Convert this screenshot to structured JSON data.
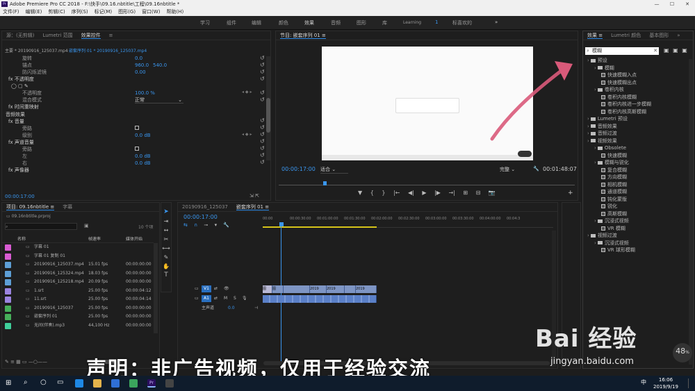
{
  "window": {
    "title": "Adobe Premiere Pro CC 2018 - F:\\快手\\09.16.nbtitle\\工程\\09.16nbtitle *",
    "app_icon": "Pr",
    "win_min": "—",
    "win_max": "☐",
    "win_close": "✕"
  },
  "menu": [
    "文件(F)",
    "编辑(E)",
    "剪辑(C)",
    "序列(S)",
    "标记(M)",
    "图形(G)",
    "窗口(W)",
    "帮助(H)"
  ],
  "workspaces": {
    "items": [
      "学习",
      "组件",
      "编辑",
      "颜色",
      "效果",
      "音频",
      "图形",
      "库",
      "Learning",
      "1",
      "标喜欢的"
    ],
    "more": "»"
  },
  "effect_controls": {
    "tabs": [
      "源：(无剪辑)",
      "Lumetri 范围",
      "效果控件",
      "≡"
    ],
    "header": {
      "master": "主要 * 20190916_125037.mp4",
      "seq": "嵌套序列 01 * 20190916_125037.mp4"
    },
    "rows": [
      {
        "label": "旋转",
        "v1": "0.0",
        "v2": ""
      },
      {
        "label": "锚点",
        "v1": "960.0",
        "v2": "540.0"
      },
      {
        "label": "防闪烁滤镜",
        "v1": "0.00",
        "v2": ""
      },
      {
        "label": "不透明度",
        "v1": "",
        "v2": ""
      },
      {
        "label": "",
        "v1": "",
        "v2": ""
      },
      {
        "label": "不透明度",
        "v1": "100.0 %",
        "v2": ""
      },
      {
        "label": "混合模式",
        "v1": "正常",
        "v2": ""
      },
      {
        "label": "时间重映射",
        "v1": "",
        "v2": ""
      },
      {
        "label": "音频效果",
        "v1": "",
        "v2": ""
      },
      {
        "label": "音量",
        "v1": "",
        "v2": ""
      },
      {
        "label": "旁路",
        "v1": "",
        "v2": ""
      },
      {
        "label": "级别",
        "v1": "0.0 dB",
        "v2": ""
      },
      {
        "label": "声道音量",
        "v1": "",
        "v2": ""
      },
      {
        "label": "旁路",
        "v1": "",
        "v2": ""
      },
      {
        "label": "左",
        "v1": "0.0 dB",
        "v2": ""
      },
      {
        "label": "右",
        "v1": "0.0 dB",
        "v2": ""
      },
      {
        "label": "声像器",
        "v1": "",
        "v2": ""
      }
    ],
    "timecode": "00:00:17:00"
  },
  "program": {
    "title": "节目: 嵌套序列 01 ≡",
    "timecode": "00:00:17:00",
    "fit": "适合",
    "quality": "完整",
    "duration": "00:01:48:07",
    "controls": [
      "▼",
      "{",
      "}",
      "|←",
      "◀|",
      "▶",
      "|▶",
      "→|",
      "⊞",
      "⊟",
      "📷",
      "+"
    ]
  },
  "project": {
    "tabs": [
      "项目: 09.16nbtitle ≡",
      "字幕"
    ],
    "file": "09.16nbtitle.prproj",
    "count": "10 个项",
    "cols": [
      "名称",
      "帧速率",
      "媒体开始"
    ],
    "items": [
      {
        "name": "字幕 01",
        "fps": "",
        "start": "",
        "color": "#d85bd2"
      },
      {
        "name": "字幕 01 复制 01",
        "fps": "",
        "start": "",
        "color": "#d85bd2"
      },
      {
        "name": "20190916_125037.mp4",
        "fps": "15.01 fps",
        "start": "00:00:00:00",
        "color": "#5d9fd6"
      },
      {
        "name": "20190916_125324.mp4",
        "fps": "18.03 fps",
        "start": "00:00:00:00",
        "color": "#5d9fd6"
      },
      {
        "name": "20190916_125218.mp4",
        "fps": "20.09 fps",
        "start": "00:00:00:00",
        "color": "#5d9fd6"
      },
      {
        "name": "1.srt",
        "fps": "25.00 fps",
        "start": "00:00:04:12",
        "color": "#9b84e0"
      },
      {
        "name": "11.srt",
        "fps": "25.00 fps",
        "start": "00:00:04:14",
        "color": "#9b84e0"
      },
      {
        "name": "20190916_125037",
        "fps": "25.00 fps",
        "start": "00:00:00:00",
        "color": "#46b05a"
      },
      {
        "name": "嵌套序列 01",
        "fps": "25.00 fps",
        "start": "00:00:00:00",
        "color": "#46b05a"
      },
      {
        "name": "无间(伴奏).mp3",
        "fps": "44,100 Hz",
        "start": "00:00:00:00",
        "color": "#3fcf9a"
      }
    ]
  },
  "timeline": {
    "tabs": [
      "20190916_125037",
      "嵌套序列 01 ≡"
    ],
    "timecode": "00:00:17:00",
    "ruler": [
      "00:00",
      "00:00:30:00",
      "00:01:00:00",
      "00:01:30:00",
      "00:02:00:00",
      "00:02:30:00",
      "00:03:00:00",
      "00:03:30:00",
      "00:04:00:00",
      "00:04:3"
    ],
    "tracks": {
      "v1": "V1",
      "a1": "A1",
      "master": "主声道",
      "master_val": "0.0"
    },
    "clips": [
      "图",
      "图",
      "2019",
      "2019",
      "2019"
    ]
  },
  "effects": {
    "tabs": [
      "效果 ≡",
      "Lumetri 颜色",
      "基本图形",
      "»"
    ],
    "search": "模糊",
    "tree": [
      {
        "t": "预设",
        "lvl": 0,
        "kind": "folder"
      },
      {
        "t": "模糊",
        "lvl": 1,
        "kind": "folder"
      },
      {
        "t": "快速模糊入点",
        "lvl": 2,
        "kind": "fx"
      },
      {
        "t": "快速模糊出点",
        "lvl": 2,
        "kind": "fx"
      },
      {
        "t": "卷积内核",
        "lvl": 1,
        "kind": "folder"
      },
      {
        "t": "卷积内核模糊",
        "lvl": 2,
        "kind": "fx"
      },
      {
        "t": "卷积内核进一步模糊",
        "lvl": 2,
        "kind": "fx"
      },
      {
        "t": "卷积内核高斯模糊",
        "lvl": 2,
        "kind": "fx"
      },
      {
        "t": "Lumetri 预设",
        "lvl": 0,
        "kind": "folder"
      },
      {
        "t": "音频效果",
        "lvl": 0,
        "kind": "folder"
      },
      {
        "t": "音频过渡",
        "lvl": 0,
        "kind": "folder"
      },
      {
        "t": "视频效果",
        "lvl": 0,
        "kind": "folder"
      },
      {
        "t": "Obsolete",
        "lvl": 1,
        "kind": "folder"
      },
      {
        "t": "快速模糊",
        "lvl": 2,
        "kind": "fx"
      },
      {
        "t": "模糊与锐化",
        "lvl": 1,
        "kind": "folder"
      },
      {
        "t": "复合模糊",
        "lvl": 2,
        "kind": "fx"
      },
      {
        "t": "方向模糊",
        "lvl": 2,
        "kind": "fx"
      },
      {
        "t": "相机模糊",
        "lvl": 2,
        "kind": "fx"
      },
      {
        "t": "通道模糊",
        "lvl": 2,
        "kind": "fx"
      },
      {
        "t": "钝化蒙版",
        "lvl": 2,
        "kind": "fx"
      },
      {
        "t": "锐化",
        "lvl": 2,
        "kind": "fx"
      },
      {
        "t": "高斯模糊",
        "lvl": 2,
        "kind": "fx"
      },
      {
        "t": "沉浸式视频",
        "lvl": 1,
        "kind": "folder"
      },
      {
        "t": "VR 模糊",
        "lvl": 2,
        "kind": "fx"
      },
      {
        "t": "视频过渡",
        "lvl": 0,
        "kind": "folder"
      },
      {
        "t": "沉浸式视频",
        "lvl": 1,
        "kind": "folder"
      },
      {
        "t": "VR 球形模糊",
        "lvl": 2,
        "kind": "fx"
      }
    ]
  },
  "overlay": {
    "caption": "声明：非广告视频，仅用于经验交流",
    "watermark": "Bai 经验",
    "watermark_url": "jingyan.baidu.com",
    "badge": "48",
    "badge_unit": "%"
  },
  "taskbar": {
    "time": "16:06",
    "date": "2019/9/19",
    "ime": "中"
  }
}
